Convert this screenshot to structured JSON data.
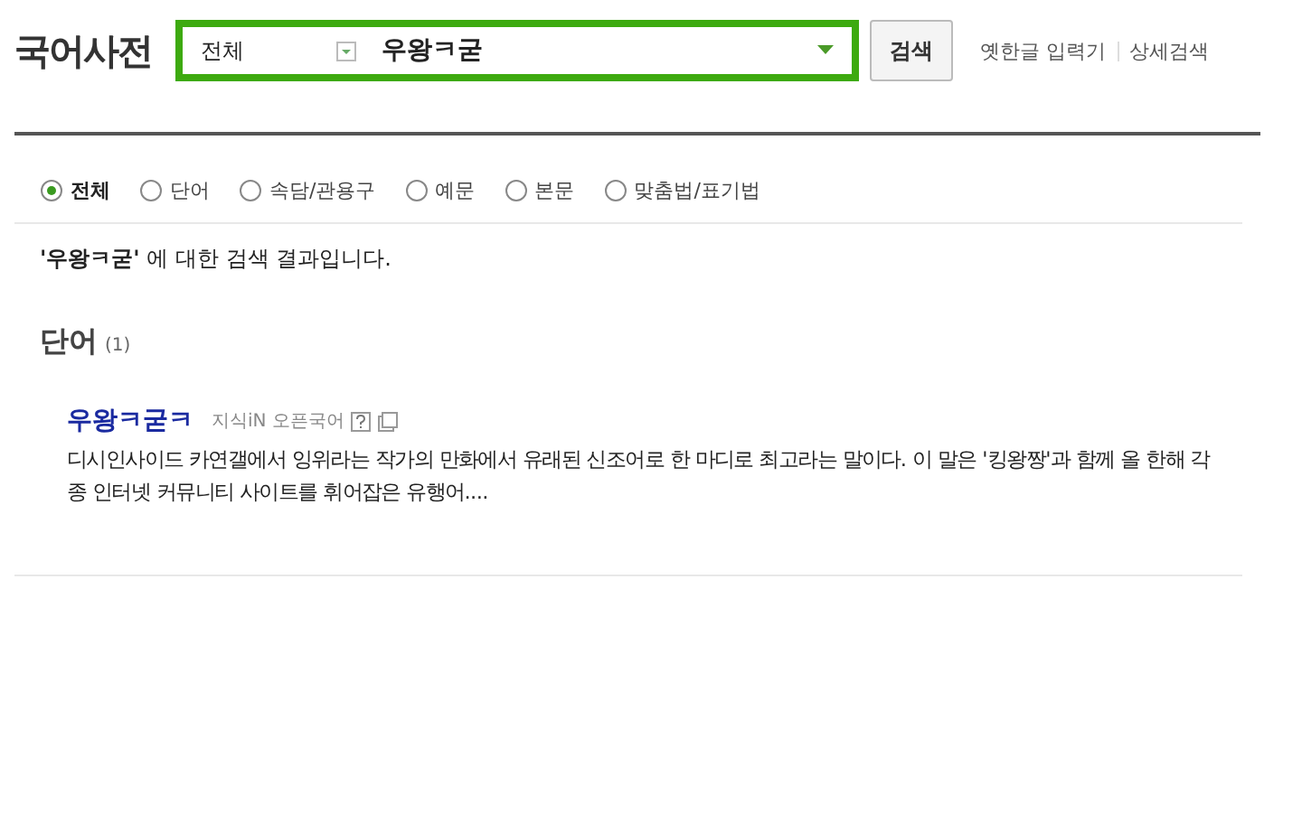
{
  "logo": "국어사전",
  "search": {
    "scope": "전체",
    "value": "우왕ㅋ굳",
    "button": "검색"
  },
  "links": [
    "옛한글 입력기",
    "상세검색"
  ],
  "filters": [
    {
      "label": "전체",
      "selected": true
    },
    {
      "label": "단어",
      "selected": false
    },
    {
      "label": "속담/관용구",
      "selected": false
    },
    {
      "label": "예문",
      "selected": false
    },
    {
      "label": "본문",
      "selected": false
    },
    {
      "label": "맞춤법/표기법",
      "selected": false
    }
  ],
  "result_summary": "**'우왕ㅋ굳'** 에 대한 검색 결과입니다.",
  "section": {
    "title": "단어",
    "count": "(1)"
  },
  "entries": [
    {
      "word": "우왕ㅋ굳ㅋ",
      "source": "지식iN 오픈국어",
      "description": "디시인사이드 카연갤에서 잉위라는 작가의 만화에서 유래된 신조어로 한 마디로 최고라는 말이다. 이 말은 '킹왕짱'과 함께 올 한해 각종 인터넷 커뮤니티 사이트를 휘어잡은 유행어...."
    }
  ]
}
